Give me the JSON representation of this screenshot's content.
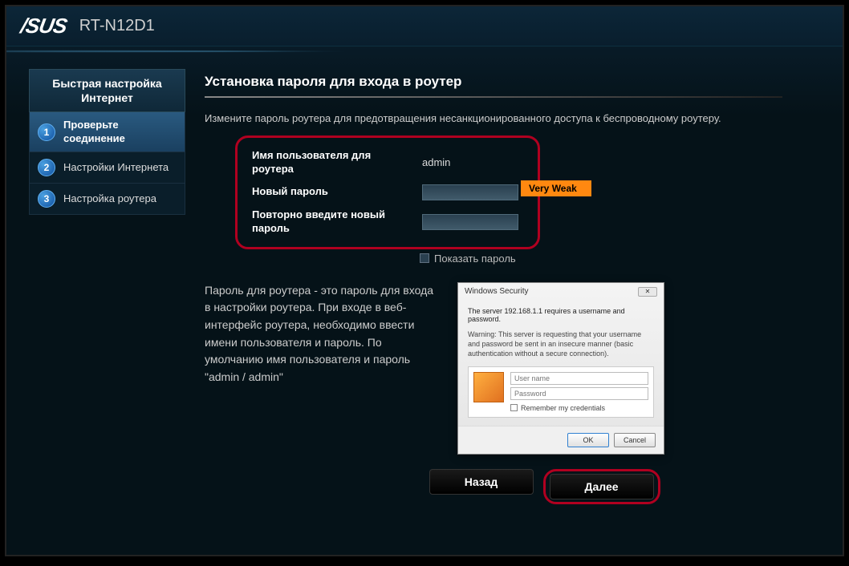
{
  "header": {
    "brand": "/SUS",
    "model": "RT-N12D1"
  },
  "sidebar": {
    "title": "Быстрая настройка Интернет",
    "steps": [
      {
        "num": "1",
        "label": "Проверьте соединение"
      },
      {
        "num": "2",
        "label": "Настройки Интернета"
      },
      {
        "num": "3",
        "label": "Настройка роутера"
      }
    ]
  },
  "main": {
    "title": "Установка пароля для входа в роутер",
    "intro": "Измените пароль роутера для предотвращения несанкционированного доступа к беспроводному роутеру.",
    "form": {
      "username_label": "Имя пользователя для роутера",
      "username_value": "admin",
      "newpw_label": "Новый пароль",
      "retype_label": "Повторно введите новый пароль",
      "strength": "Very Weak",
      "show_pw": "Показать пароль"
    },
    "description": "Пароль для роутера - это пароль для входа в настройки роутера. При входе в веб-интерфейс роутера, необходимо ввести имени пользователя и пароль. По умолчанию имя пользователя и пароль \"admin / admin\"",
    "dialog": {
      "title": "Windows Security",
      "line1": "The server 192.168.1.1  requires a username and password.",
      "line2": "Warning: This server is requesting that your username and password be sent in an insecure manner (basic authentication without a secure connection).",
      "user_ph": "User name",
      "pass_ph": "Password",
      "remember": "Remember my credentials",
      "ok": "OK",
      "cancel": "Cancel"
    },
    "nav": {
      "back": "Назад",
      "next": "Далее"
    }
  }
}
